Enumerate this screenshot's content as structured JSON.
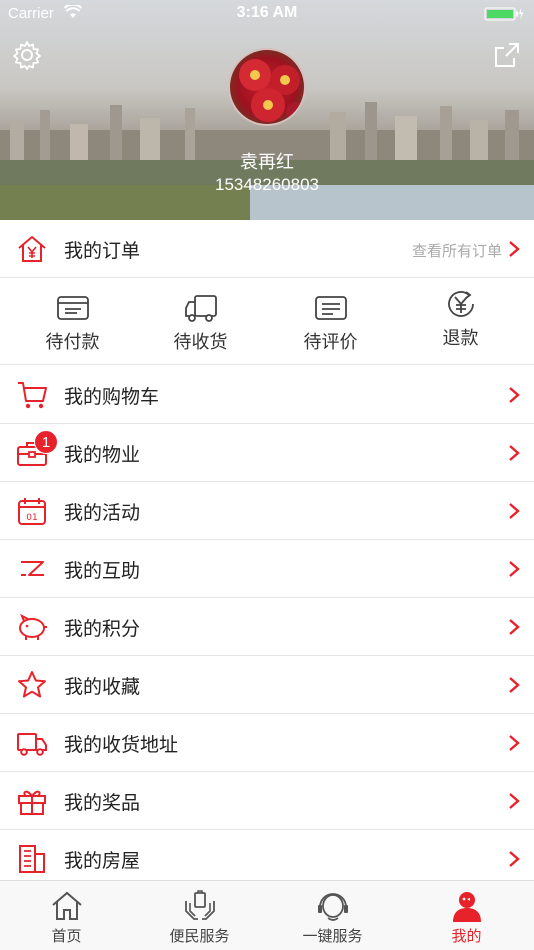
{
  "status_bar": {
    "carrier": "Carrier",
    "time": "3:16 AM"
  },
  "header": {
    "user_name": "袁再红",
    "phone": "15348260803"
  },
  "orders": {
    "title": "我的订单",
    "view_all": "查看所有订单",
    "statuses": [
      "待付款",
      "待收货",
      "待评价",
      "退款"
    ]
  },
  "menu": [
    {
      "label": "我的购物车",
      "icon": "cart-icon"
    },
    {
      "label": "我的物业",
      "icon": "briefcase-icon",
      "badge": "1"
    },
    {
      "label": "我的活动",
      "icon": "calendar-icon"
    },
    {
      "label": "我的互助",
      "icon": "exchange-icon"
    },
    {
      "label": "我的积分",
      "icon": "piggy-bank-icon"
    },
    {
      "label": "我的收藏",
      "icon": "star-icon"
    },
    {
      "label": "我的收货地址",
      "icon": "truck-icon"
    },
    {
      "label": "我的奖品",
      "icon": "gift-icon"
    },
    {
      "label": "我的房屋",
      "icon": "building-icon"
    }
  ],
  "tabs": [
    {
      "label": "首页",
      "icon": "home-icon",
      "active": false
    },
    {
      "label": "便民服务",
      "icon": "service-hands-icon",
      "active": false
    },
    {
      "label": "一键服务",
      "icon": "headset-icon",
      "active": false
    },
    {
      "label": "我的",
      "icon": "user-icon",
      "active": true
    }
  ],
  "colors": {
    "accent": "#e8222b",
    "separator": "#e5e5e5",
    "muted": "#aaaaaa"
  }
}
